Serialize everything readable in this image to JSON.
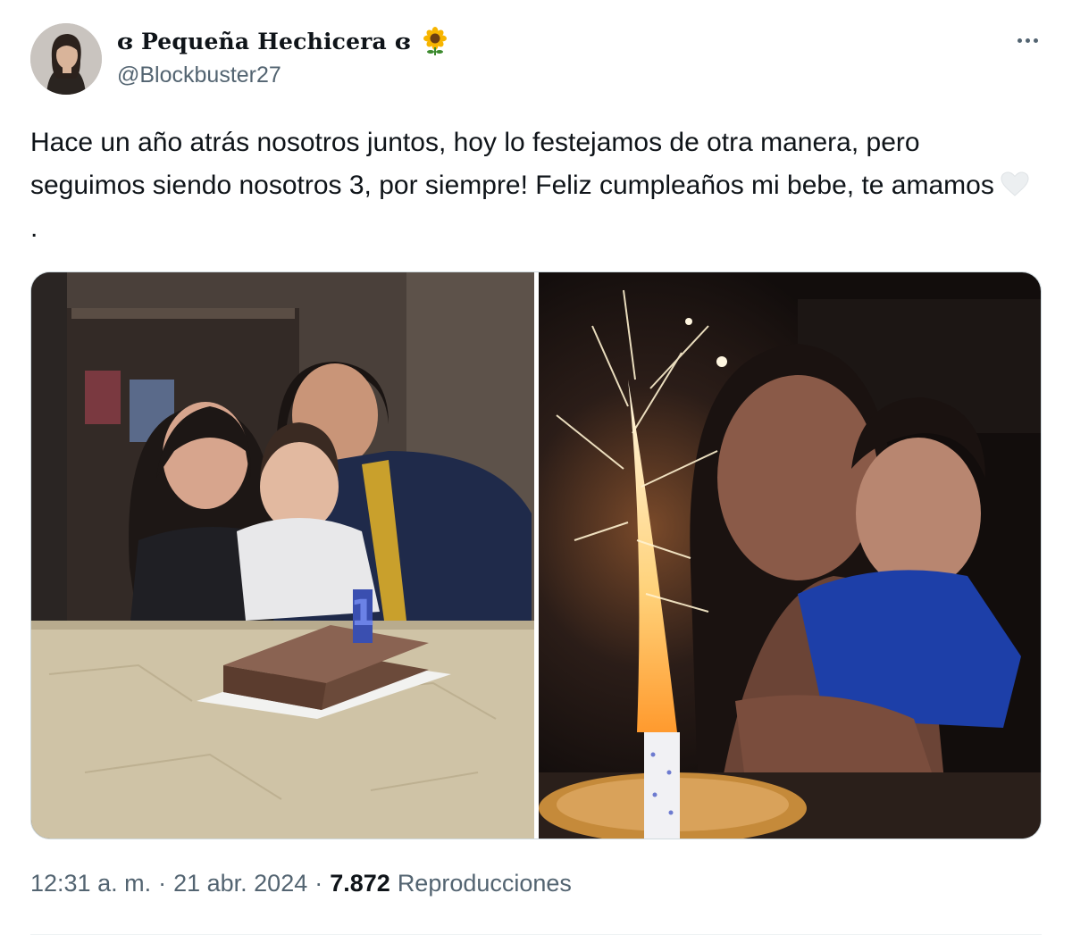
{
  "author": {
    "display_name": "ɞ Pequeña Hechicera ɞ",
    "handle": "@Blockbuster27",
    "name_emoji": "sunflower-icon"
  },
  "tweet": {
    "text": "Hace un año atrás nosotros juntos, hoy lo festejamos de otra manera, pero seguimos siendo nosotros 3, por siempre! Feliz cumpleaños mi bebe, te amamos",
    "text_end": ".",
    "emoji": "white-heart-icon"
  },
  "media": {
    "left_cake_number": "1",
    "right_overlay_text": ""
  },
  "meta": {
    "time": "12:31 a. m.",
    "date": "21 abr. 2024",
    "separator": "·",
    "views_count": "7.872",
    "views_label": "Reproducciones"
  },
  "colors": {
    "text": "#0f1419",
    "secondary": "#536471",
    "border": "#cfd9de"
  }
}
